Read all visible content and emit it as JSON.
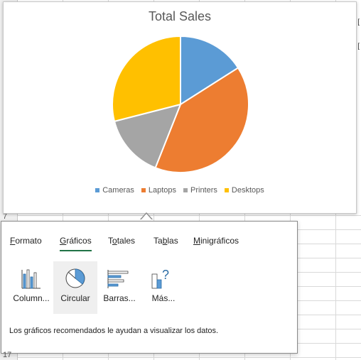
{
  "sheet": {
    "row_label_7": "7",
    "row_label_17": "17"
  },
  "chart": {
    "title": "Total Sales",
    "legend": [
      {
        "label": "Cameras",
        "color": "#5b9bd5"
      },
      {
        "label": "Laptops",
        "color": "#ed7d31"
      },
      {
        "label": "Printers",
        "color": "#a5a5a5"
      },
      {
        "label": "Desktops",
        "color": "#ffc000"
      }
    ]
  },
  "chart_data": {
    "type": "pie",
    "title": "Total Sales",
    "categories": [
      "Cameras",
      "Laptops",
      "Printers",
      "Desktops"
    ],
    "values": [
      16,
      40,
      15,
      29
    ],
    "colors": [
      "#5b9bd5",
      "#ed7d31",
      "#a5a5a5",
      "#ffc000"
    ],
    "legend_position": "bottom"
  },
  "quick_analysis": {
    "tabs": [
      {
        "pre": "",
        "ul": "F",
        "post": "ormato",
        "name": "tab-formato"
      },
      {
        "pre": "",
        "ul": "G",
        "post": "ráficos",
        "name": "tab-graficos"
      },
      {
        "pre": "T",
        "ul": "o",
        "post": "tales",
        "name": "tab-totales"
      },
      {
        "pre": "Ta",
        "ul": "b",
        "post": "las",
        "name": "tab-tablas"
      },
      {
        "pre": "",
        "ul": "M",
        "post": "inigráficos",
        "name": "tab-minigraficos"
      }
    ],
    "active_tab": "Gráficos",
    "options": [
      {
        "label": "Column...",
        "icon": "column-chart-icon"
      },
      {
        "label": "Circular",
        "icon": "pie-chart-icon"
      },
      {
        "label": "Barras...",
        "icon": "bar-chart-icon"
      },
      {
        "label": "Más...",
        "icon": "more-charts-icon"
      }
    ],
    "description": "Los gráficos recomendados le ayudan a visualizar los datos."
  }
}
